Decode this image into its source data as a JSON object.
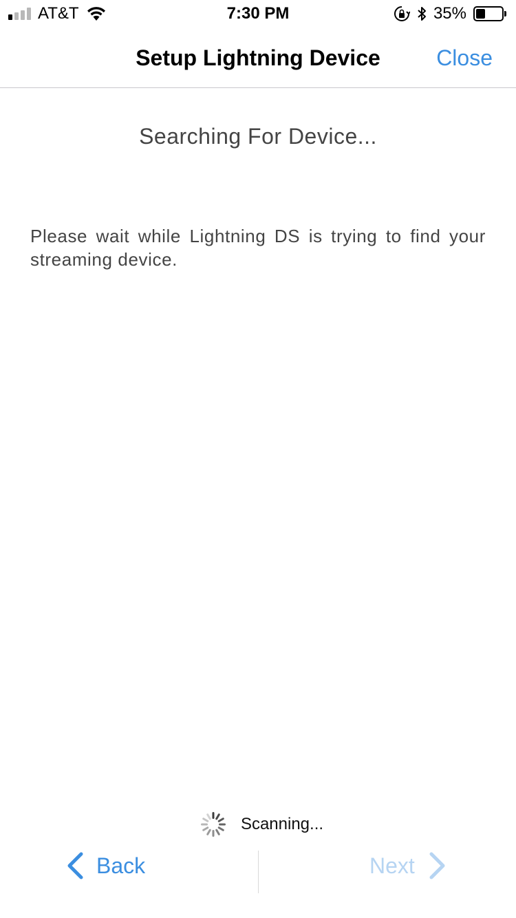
{
  "status_bar": {
    "carrier": "AT&T",
    "time": "7:30 PM",
    "battery_percent_label": "35%",
    "battery_level": 0.35,
    "signal_bars_active": 1,
    "signal_bars_total": 4,
    "icons": [
      "wifi-icon",
      "orientation-lock-icon",
      "bluetooth-icon",
      "battery-icon"
    ]
  },
  "nav": {
    "title": "Setup Lightning Device",
    "close_label": "Close"
  },
  "content": {
    "heading": "Searching For Device...",
    "description": "Please wait while Lightning DS is trying to find your streaming device."
  },
  "scanning": {
    "label": "Scanning...",
    "icon": "activity-spinner-icon"
  },
  "bottom_nav": {
    "back_label": "Back",
    "next_label": "Next",
    "next_enabled": false
  },
  "colors": {
    "accent": "#3b8ee0",
    "accent_disabled": "#b6d4f2",
    "text": "#444444",
    "separator": "#c8c7cc"
  }
}
